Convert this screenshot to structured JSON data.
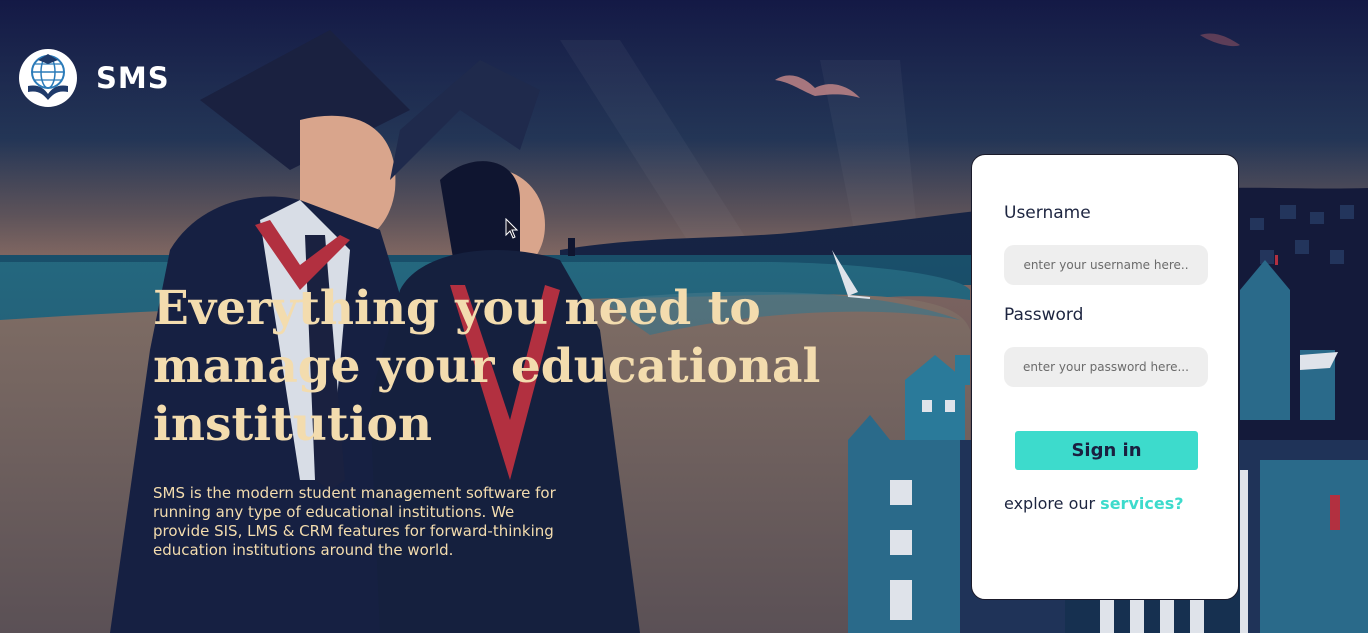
{
  "brand": {
    "name": "SMS",
    "logo_icon": "globe-book-icon"
  },
  "hero": {
    "title": "Everything you need to manage your educational institution",
    "description": "SMS is the modern student management software for running any type of educational institutions. We provide SIS, LMS & CRM features for forward-thinking education institutions around the world."
  },
  "login": {
    "username_label": "Username",
    "username_placeholder": "enter your username here..",
    "password_label": "Password",
    "password_placeholder": "enter your password here...",
    "signin_label": "Sign in",
    "explore_prefix": "explore our ",
    "services_link": "services?"
  },
  "colors": {
    "accent": "#3ddbcc",
    "heading": "#f3dcae",
    "sky": "#1a2446",
    "card": "#ffffff"
  }
}
